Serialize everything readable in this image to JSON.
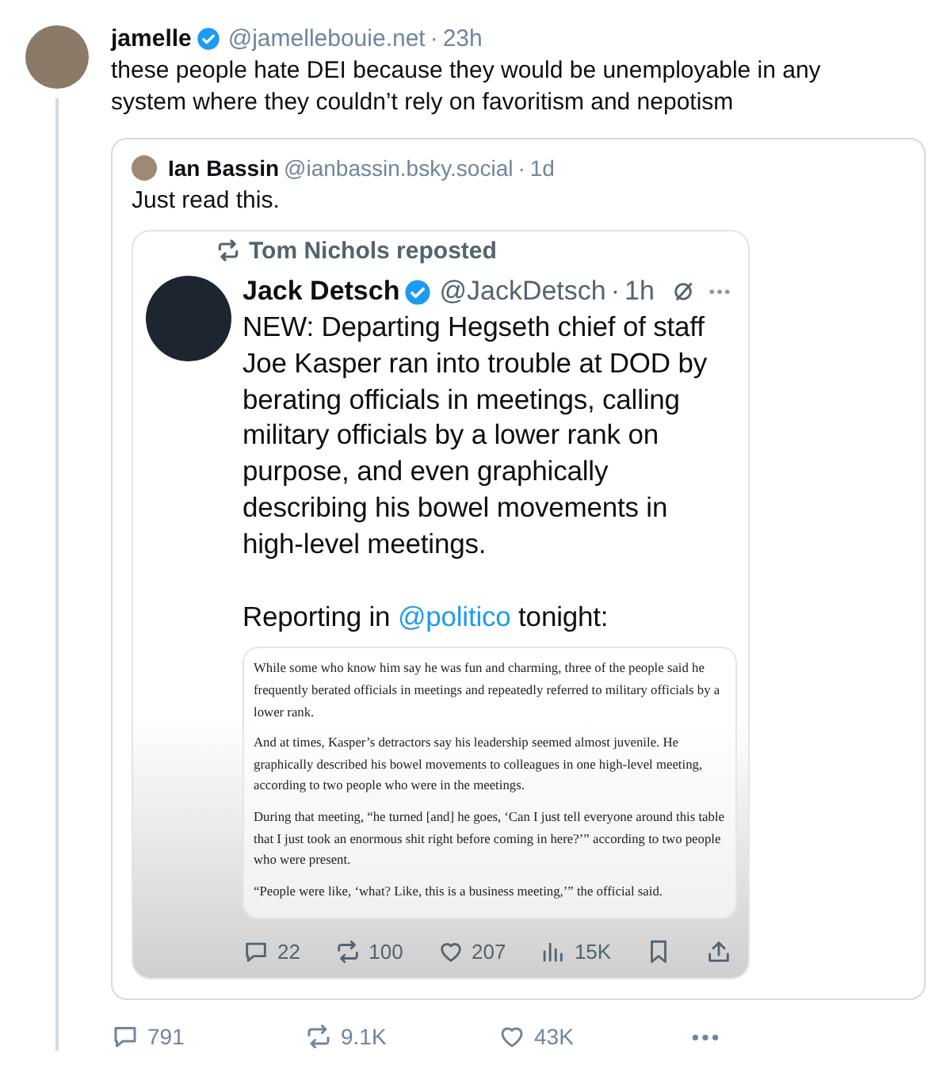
{
  "post": {
    "author": {
      "name": "jamelle",
      "verified": true,
      "handle": "@jamellebouie.net",
      "separator": "·",
      "time": "23h"
    },
    "text": "these people hate DEI because they would be unemployable in any system where they couldn’t rely on favoritism and nepotism",
    "quote": {
      "author": {
        "name": "Ian Bassin",
        "handle": "@ianbassin.bsky.social",
        "separator": "·",
        "time": "1d"
      },
      "text": "Just read this.",
      "screenshot": {
        "repost_label": "Tom Nichols reposted",
        "author": {
          "name": "Jack Detsch",
          "verified": true,
          "handle": "@JackDetsch",
          "separator": "·",
          "time": "1h"
        },
        "text": "NEW: Departing Hegseth chief of staff Joe Kasper ran into trouble at DOD by berating officials in meetings, calling military officials by a lower rank on purpose, and even graphically describing his bowel movements in high-level meetings.",
        "reporting": {
          "before": "Reporting in ",
          "link": "@politico",
          "after": " tonight:"
        },
        "article": [
          "While some who know him say he was fun and charming, three of the people said he frequently berated officials in meetings and repeatedly referred to military officials by a lower rank.",
          "And at times, Kasper’s detractors say his leadership seemed almost juvenile. He graphically described his bowel movements to colleagues in one high-level meeting, according to two people who were in the meetings.",
          "During that meeting, “he turned [and] he goes, ‘Can I just tell everyone around this table that I just took an enormous shit right before coming in here?’” according to two people who were present.",
          "“People were like, ‘what? Like, this is a business meeting,’” the official said."
        ],
        "stats": [
          {
            "kind": "reply",
            "count": "22"
          },
          {
            "kind": "repost",
            "count": "100"
          },
          {
            "kind": "like",
            "count": "207"
          },
          {
            "kind": "views",
            "count": "15K"
          },
          {
            "kind": "bookmark"
          },
          {
            "kind": "share"
          }
        ]
      }
    },
    "actions": [
      {
        "kind": "reply",
        "count": "791"
      },
      {
        "kind": "repost",
        "count": "9.1K"
      },
      {
        "kind": "like",
        "count": "43K"
      },
      {
        "kind": "more"
      }
    ]
  }
}
